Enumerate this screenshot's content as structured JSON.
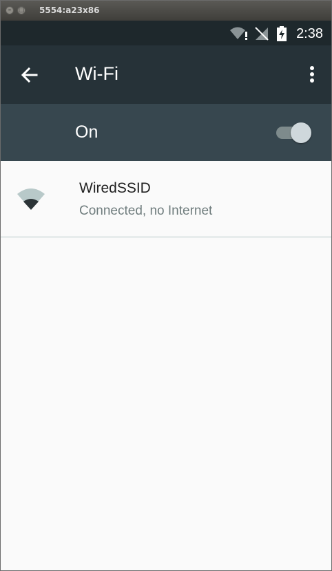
{
  "window": {
    "title": "5554:a23x86"
  },
  "status_bar": {
    "time": "2:38"
  },
  "toolbar": {
    "title": "Wi-Fi"
  },
  "switch_bar": {
    "label": "On",
    "state": "on"
  },
  "networks": [
    {
      "ssid": "WiredSSID",
      "summary": "Connected, no Internet",
      "icon": "wifi-signal-icon"
    }
  ],
  "colors": {
    "toolbar": "#263238",
    "switch_bar": "#37474f",
    "status_bar": "#1e282c",
    "background": "#fafafa"
  }
}
